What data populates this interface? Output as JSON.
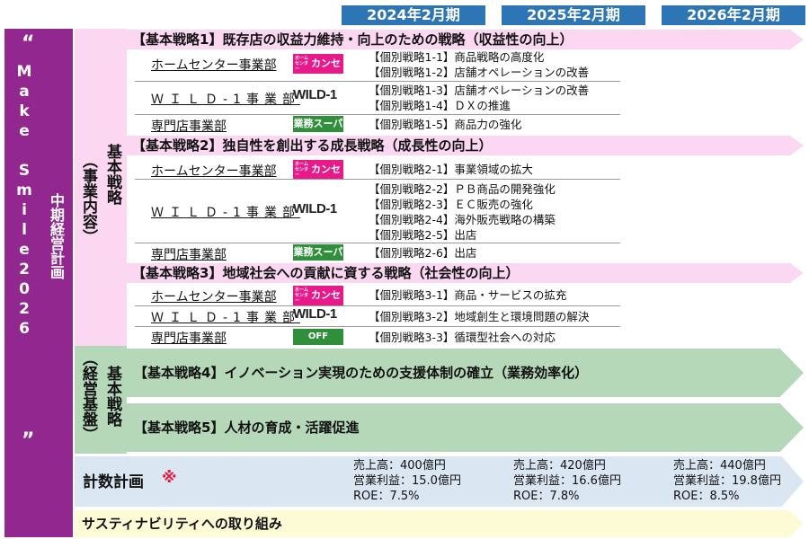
{
  "years": [
    "2024年2月期",
    "2025年2月期",
    "2026年2月期"
  ],
  "plan": {
    "quote_open": "“",
    "name": "Make Smile2026",
    "quote_close": "”",
    "subtitle": "中期経営計画"
  },
  "categories": {
    "business": {
      "title": "基本戦略",
      "paren": "（事業内容）"
    },
    "foundation": {
      "title": "基本戦略",
      "paren": "（経営基盤）"
    }
  },
  "strategies": [
    {
      "title": "【基本戦略1】既存店の収益力維持・向上のための戦略（収益性の向上）",
      "rows": [
        {
          "business": "ホームセンター事業部",
          "logo": "kanseki-logo",
          "logo_text": "カンセキ",
          "logo_pre": "ホームセンター",
          "items": [
            "【個別戦略1-1】商品戦略の高度化",
            "【個別戦略1-2】店舗オペレーションの改善"
          ]
        },
        {
          "business": "ＷＩＬＤ-1事業部",
          "logo": "wild1-logo",
          "logo_text": "WILD-1",
          "items": [
            "【個別戦略1-3】店舗オペレーションの改善",
            "【個別戦略1-4】ＤＸの推進"
          ]
        },
        {
          "business": "専門店事業部",
          "logo": "gyomu-super-logo",
          "logo_text": "業務スーパー",
          "items": [
            "【個別戦略1-5】商品力の強化"
          ]
        }
      ]
    },
    {
      "title": "【基本戦略2】独自性を創出する成長戦略（成長性の向上）",
      "rows": [
        {
          "business": "ホームセンター事業部",
          "logo": "kanseki-logo",
          "logo_text": "カンセキ",
          "logo_pre": "ホームセンター",
          "items": [
            "【個別戦略2-1】事業領域の拡大"
          ]
        },
        {
          "business": "ＷＩＬＤ-1事業部",
          "logo": "wild1-logo",
          "logo_text": "WILD-1",
          "items": [
            "【個別戦略2-2】ＰＢ商品の開発強化",
            "【個別戦略2-3】ＥＣ販売の強化",
            "【個別戦略2-4】海外販売戦略の構築",
            "【個別戦略2-5】出店"
          ]
        },
        {
          "business": "専門店事業部",
          "logo": "gyomu-super-logo",
          "logo_text": "業務スーパー",
          "items": [
            "【個別戦略2-6】出店"
          ]
        }
      ]
    },
    {
      "title": "【基本戦略3】地域社会への貢献に資する戦略（社会性の向上）",
      "rows": [
        {
          "business": "ホームセンター事業部",
          "logo": "kanseki-logo",
          "logo_text": "カンセキ",
          "logo_pre": "ホームセンター",
          "items": [
            "【個別戦略3-1】商品・サービスの拡充"
          ]
        },
        {
          "business": "ＷＩＬＤ-1事業部",
          "logo": "wild1-logo",
          "logo_text": "WILD-1",
          "items": [
            "【個別戦略3-2】地域創生と環境問題の解決"
          ]
        },
        {
          "business": "専門店事業部",
          "logo": "off-house-logo",
          "logo_text": "OFF HOUSE",
          "items": [
            "【個別戦略3-3】循環型社会への対応"
          ]
        }
      ]
    }
  ],
  "foundation_strategies": [
    "【基本戦略4】イノベーション実現のための支援体制の確立（業務効率化）",
    "【基本戦略5】人材の育成・活躍促進"
  ],
  "numeric_plan": {
    "title": "計数計画",
    "mark": "※",
    "columns": [
      {
        "sales": "売上高：400億円",
        "op_income": "営業利益：15.0億円",
        "roe": "ROE：7.5%"
      },
      {
        "sales": "売上高：420億円",
        "op_income": "営業利益：16.6億円",
        "roe": "ROE：7.8%"
      },
      {
        "sales": "売上高：440億円",
        "op_income": "営業利益：19.8億円",
        "roe": "ROE：8.5%"
      }
    ]
  },
  "sustainability": "サスティナビリティへの取り組み",
  "colors": {
    "purple": "#92278f",
    "pink": "#fbd7f2",
    "green": "#b5d8b9",
    "blue": "#2e75b6",
    "numbers_bg": "#dbe6f3",
    "sustain_bg": "#fdfbd5",
    "mark_red": "#e0193a"
  }
}
